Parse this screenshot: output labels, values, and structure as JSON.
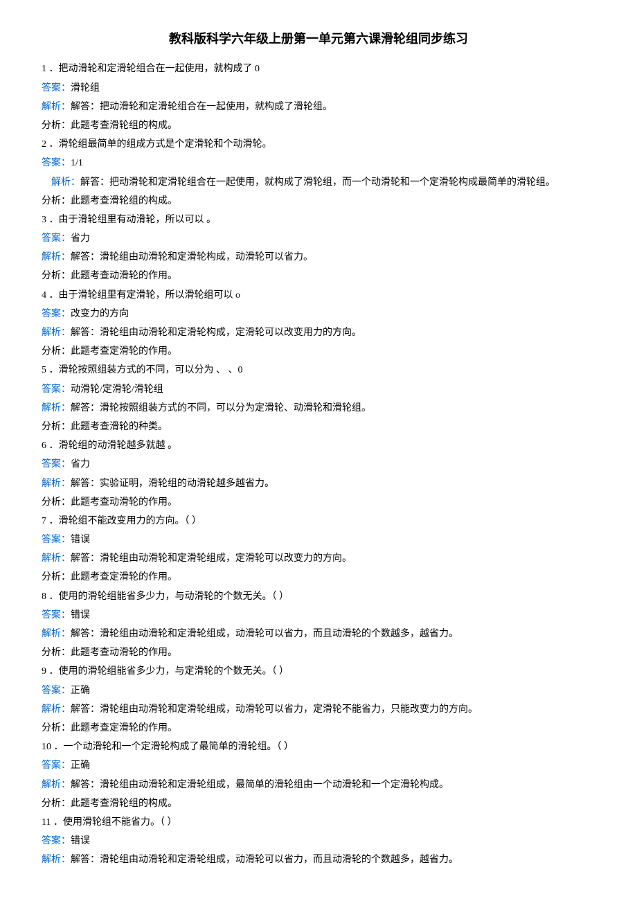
{
  "title": "教科版科学六年级上册第一单元第六课滑轮组同步练习",
  "items": [
    {
      "num": "1",
      "q": "．把动滑轮和定滑轮组合在一起使用，就构成了 0",
      "ans_label": "答案：",
      "ans": "滑轮组",
      "jx_label": "解析：",
      "jx": "解答：把动滑轮和定滑轮组合在一起使用，就构成了滑轮组。",
      "fx": "分析：此题考查滑轮组的构成。"
    },
    {
      "num": "2",
      "q": "．滑轮组最简单的组成方式是个定滑轮和个动滑轮。",
      "ans_label": "答案：",
      "ans": "1/1",
      "jx_label": "解析：",
      "jx_indent": true,
      "jx": "解答：把动滑轮和定滑轮组合在一起使用，就构成了滑轮组，而一个动滑轮和一个定滑轮构成最简单的滑轮组。",
      "fx": "分析：此题考查滑轮组的构成。"
    },
    {
      "num": "3",
      "q": "．由于滑轮组里有动滑轮，所以可以 。",
      "ans_label": "答案：",
      "ans": "省力",
      "jx_label": "解析：",
      "jx": "解答：滑轮组由动滑轮和定滑轮构成，动滑轮可以省力。",
      "fx": "分析：此题考查动滑轮的作用。"
    },
    {
      "num": "4",
      "q": "．由于滑轮组里有定滑轮，所以滑轮组可以 o",
      "ans_label": "答案：",
      "ans": "改变力的方向",
      "jx_label": "解析：",
      "jx": "解答：滑轮组由动滑轮和定滑轮构成，定滑轮可以改变用力的方向。",
      "fx": "分析：此题考查定滑轮的作用。"
    },
    {
      "num": "5",
      "q": "．滑轮按照组装方式的不同，可以分为 、 、0",
      "ans_label": "答案：",
      "ans": "动滑轮/定滑轮/滑轮组",
      "jx_label": "解析：",
      "jx": "解答：滑轮按照组装方式的不同，可以分为定滑轮、动滑轮和滑轮组。",
      "fx": "分析：此题考查滑轮的种类。"
    },
    {
      "num": "6",
      "q": "．滑轮组的动滑轮越多就越 。",
      "ans_label": "答案：",
      "ans": "省力",
      "jx_label": "解析：",
      "jx": "解答：实验证明，滑轮组的动滑轮越多越省力。",
      "fx": "分析：此题考查动滑轮的作用。"
    },
    {
      "num": "7",
      "q": "．滑轮组不能改变用力的方向。（    ）",
      "ans_label": "答案：",
      "ans": "错误",
      "jx_label": "解析：",
      "jx": "解答：滑轮组由动滑轮和定滑轮组成，定滑轮可以改变力的方向。",
      "fx": "分析：此题考查定滑轮的作用。"
    },
    {
      "num": "8",
      "q": "．使用的滑轮组能省多少力，与动滑轮的个数无关。（      ）",
      "ans_label": "答案：",
      "ans": "错误",
      "jx_label": "解析：",
      "jx": "解答：滑轮组由动滑轮和定滑轮组成，动滑轮可以省力，而且动滑轮的个数越多，越省力。",
      "fx": "分析：此题考查动滑轮的作用。"
    },
    {
      "num": "9",
      "q": "．使用的滑轮组能省多少力，与定滑轮的个数无关。（      ）",
      "ans_label": "答案：",
      "ans": "正确",
      "jx_label": "解析：",
      "jx": "解答：滑轮组由动滑轮和定滑轮组成，动滑轮可以省力，定滑轮不能省力，只能改变力的方向。",
      "fx": "分析：此题考查定滑轮的作用。"
    },
    {
      "num": "10",
      "q": "．一个动滑轮和一个定滑轮构成了最简单的滑轮组。（      ）",
      "ans_label": "答案：",
      "ans": "正确",
      "jx_label": "解析：",
      "jx": "解答：滑轮组由动滑轮和定滑轮组成，最简单的滑轮组由一个动滑轮和一个定滑轮构成。",
      "fx": "分析：此题考查滑轮组的构成。"
    },
    {
      "num": "11",
      "q": "．使用滑轮组不能省力。（   ）",
      "ans_label": "答案：",
      "ans": "错误",
      "jx_label": "解析：",
      "jx": "解答：滑轮组由动滑轮和定滑轮组成，动滑轮可以省力，而且动滑轮的个数越多，越省力。",
      "fx": ""
    }
  ]
}
